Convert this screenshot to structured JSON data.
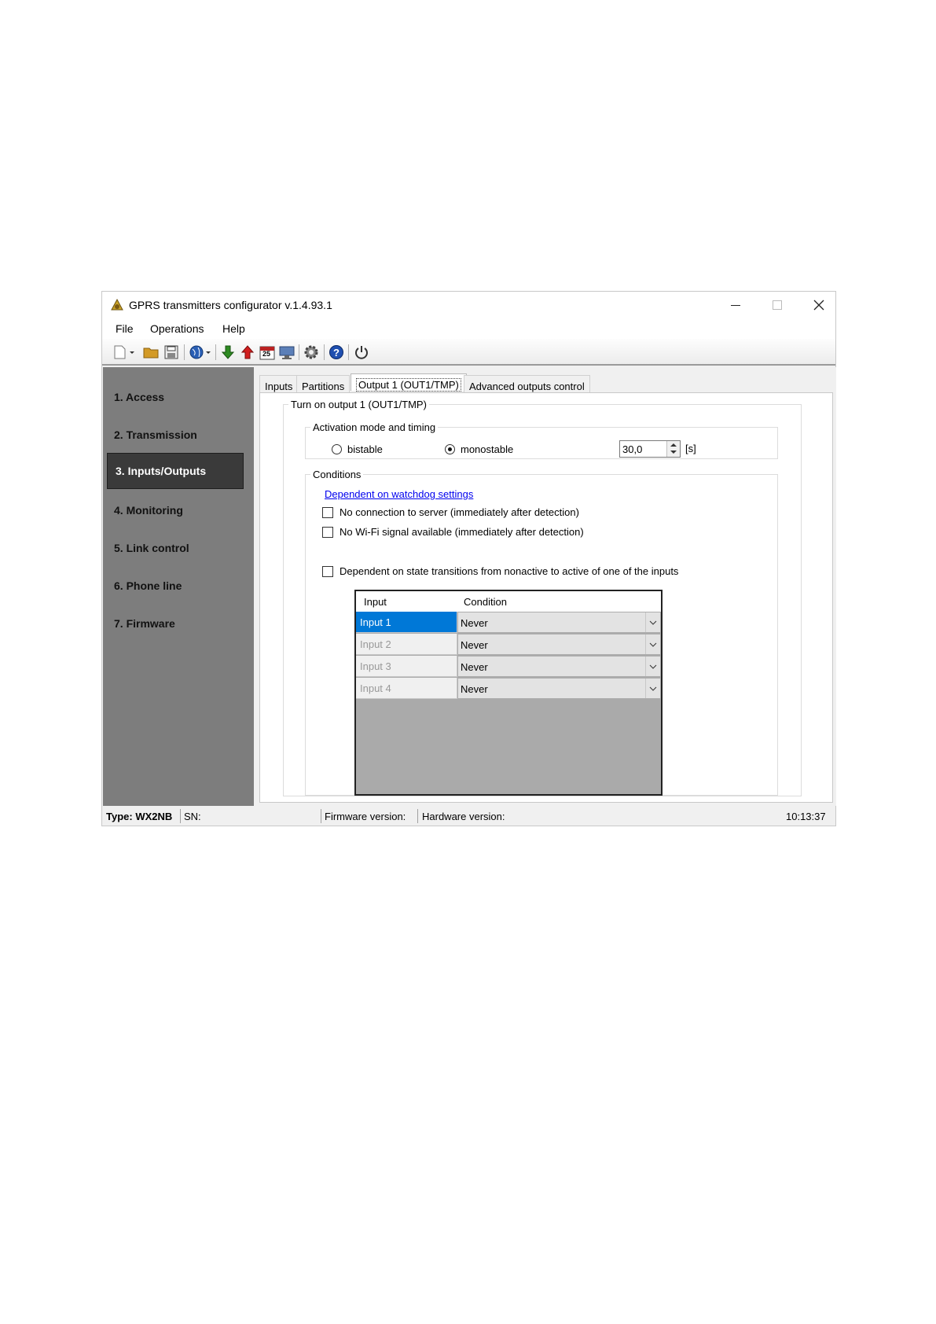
{
  "window": {
    "title": "GPRS transmitters configurator v.1.4.93.1",
    "controls": {
      "minimize": "minimize-icon",
      "maximize": "maximize-icon",
      "close": "close-icon"
    }
  },
  "menu": [
    "File",
    "Operations",
    "Help"
  ],
  "toolbar": {
    "icons": [
      "new-document-icon",
      "open-folder-icon",
      "save-icon",
      "globe-icon",
      "download-arrow-icon",
      "upload-arrow-icon",
      "calendar-icon",
      "monitor-icon",
      "settings-gear-icon",
      "help-icon",
      "power-icon"
    ],
    "calendar_text": "25"
  },
  "sidebar": {
    "items": [
      {
        "label": "1. Access",
        "active": false
      },
      {
        "label": "2. Transmission",
        "active": false
      },
      {
        "label": "3. Inputs/Outputs",
        "active": true
      },
      {
        "label": "4. Monitoring",
        "active": false
      },
      {
        "label": "5. Link control",
        "active": false
      },
      {
        "label": "6. Phone line",
        "active": false
      },
      {
        "label": "7. Firmware",
        "active": false
      }
    ]
  },
  "tabs": [
    {
      "label": "Inputs",
      "selected": false
    },
    {
      "label": "Partitions",
      "selected": false
    },
    {
      "label": "Output 1 (OUT1/TMP)",
      "selected": true
    },
    {
      "label": "Advanced outputs control",
      "selected": false
    }
  ],
  "output": {
    "group_title": "Turn on output 1 (OUT1/TMP)",
    "activation": {
      "title": "Activation mode and timing",
      "bistable_label": "bistable",
      "monostable_label": "monostable",
      "selected_mode": "monostable",
      "time_value": "30,0",
      "time_unit": "[s]"
    },
    "conditions": {
      "title": "Conditions",
      "watchdog_link": "Dependent on watchdog settings",
      "no_server_label": "No connection to server (immediately after detection)",
      "no_server_checked": false,
      "no_wifi_label": "No Wi-Fi signal available (immediately after detection)",
      "no_wifi_checked": false,
      "dependent_label": "Dependent on state transitions from nonactive to active of one of the inputs",
      "dependent_checked": false,
      "table": {
        "headers": [
          "Input",
          "Condition"
        ],
        "rows": [
          {
            "input": "Input 1",
            "condition": "Never"
          },
          {
            "input": "Input 2",
            "condition": "Never"
          },
          {
            "input": "Input 3",
            "condition": "Never"
          },
          {
            "input": "Input 4",
            "condition": "Never"
          }
        ]
      }
    }
  },
  "status": {
    "type": "Type: WX2NB",
    "sn": "SN:",
    "firmware": "Firmware version:",
    "hardware": "Hardware version:",
    "time": "10:13:37"
  },
  "colors": {
    "sidebar_bg": "#7d7d7d",
    "sidebar_active": "#3a3a3a",
    "selection": "#0078d7",
    "link": "#0000ee"
  }
}
